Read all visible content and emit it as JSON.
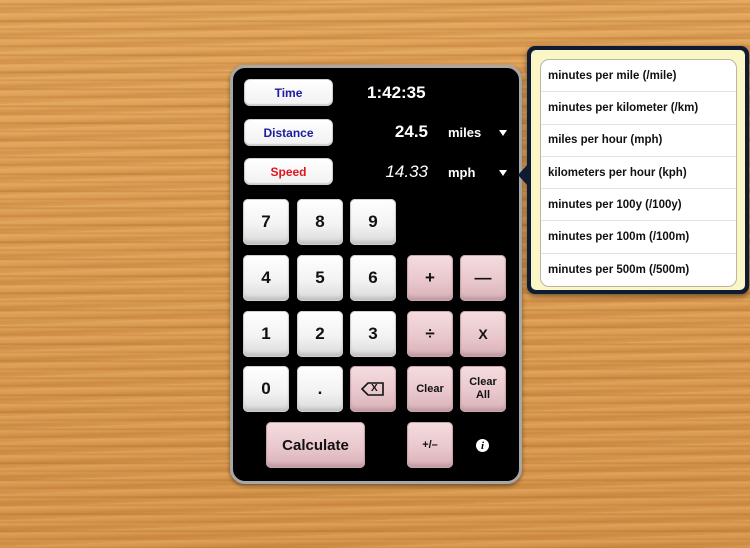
{
  "fields": {
    "time": {
      "label": "Time",
      "value": "1:42:35"
    },
    "distance": {
      "label": "Distance",
      "value": "24.5",
      "unit": "miles"
    },
    "speed": {
      "label": "Speed",
      "value": "14.33",
      "unit": "mph"
    }
  },
  "keypad": {
    "digits": [
      "7",
      "8",
      "9",
      "4",
      "5",
      "6",
      "1",
      "2",
      "3",
      "0",
      "."
    ],
    "plus": "+",
    "minus": "—",
    "divide": "÷",
    "multiply": "X",
    "backspace_glyph": "X",
    "clear": "Clear",
    "clear_all_line1": "Clear",
    "clear_all_line2": "All",
    "calculate": "Calculate",
    "sign": "+/–",
    "info": "i"
  },
  "speed_unit_menu": {
    "items": [
      "minutes per mile (/mile)",
      "minutes per kilometer (/km)",
      "miles per hour (mph)",
      "kilometers per hour (kph)",
      "minutes per 100y (/100y)",
      "minutes per 100m (/100m)",
      "minutes per 500m (/500m)"
    ]
  },
  "colors": {
    "field_label": "#1c1c9c",
    "active_field_label": "#e1141c",
    "popover_background": "#fbf6c6",
    "popover_border": "#0f1a33"
  }
}
